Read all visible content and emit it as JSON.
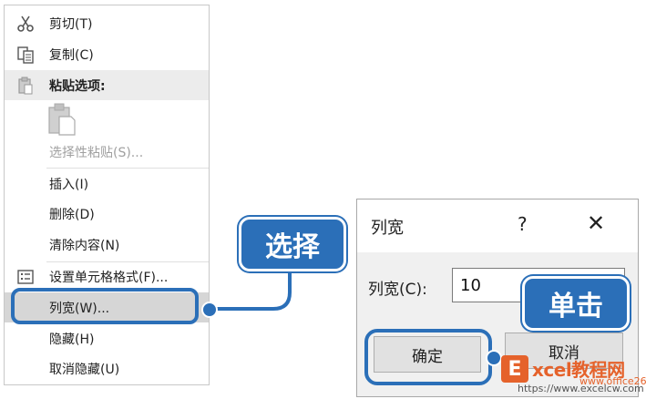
{
  "context_menu": {
    "cut": "剪切(T)",
    "copy": "复制(C)",
    "paste_options": "粘贴选项:",
    "paste_special": "选择性粘贴(S)...",
    "insert": "插入(I)",
    "delete": "删除(D)",
    "clear_contents": "清除内容(N)",
    "format_cells": "设置单元格格式(F)...",
    "column_width": "列宽(W)...",
    "hide": "隐藏(H)",
    "unhide": "取消隐藏(U)"
  },
  "callouts": {
    "select": "选择",
    "click": "单击"
  },
  "dialog": {
    "title": "列宽",
    "help": "?",
    "close": "✕",
    "field_label": "列宽(C):",
    "field_value": "10",
    "ok_label": "确定",
    "cancel_label": "取消"
  },
  "watermark": {
    "logo_letter": "E",
    "brand": "xcel教程网",
    "url1": "www.office26.com",
    "url2": "https://www.excelcw.com"
  },
  "colors": {
    "accent": "#2b6fb8",
    "brand_orange": "#e5622b"
  }
}
